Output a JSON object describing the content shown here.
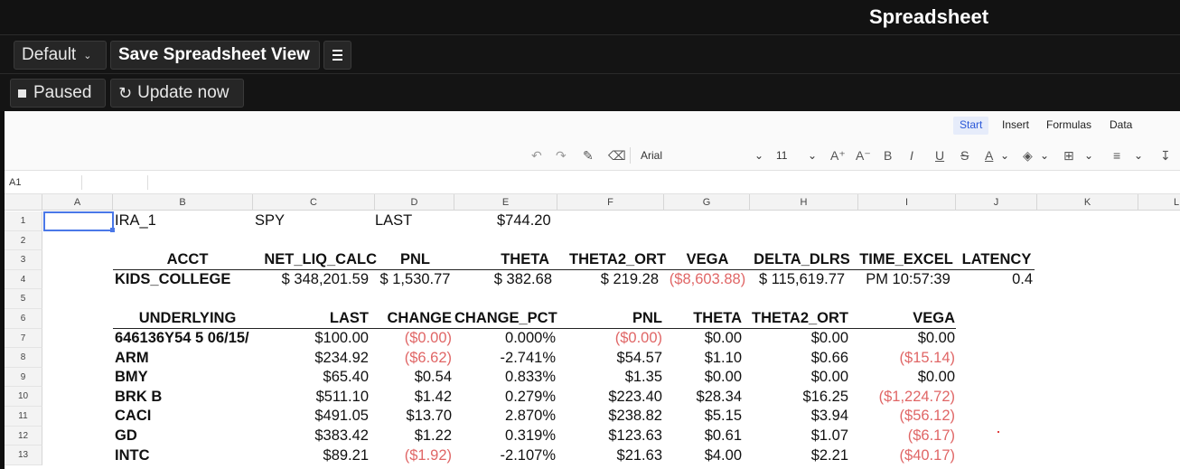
{
  "app": {
    "title": "Spreadsheet"
  },
  "toolbar": {
    "view_select": "Default",
    "save_label": "Save Spreadsheet View",
    "paused_label": "Paused",
    "update_label": "Update now"
  },
  "ribbon": {
    "tabs": [
      "Start",
      "Insert",
      "Formulas",
      "Data"
    ],
    "active_tab": "Start",
    "font": "Arial",
    "font_size": "11",
    "formula_bar": {
      "cell_ref": "A1",
      "content": ""
    }
  },
  "grid": {
    "columns": [
      "A",
      "B",
      "C",
      "D",
      "E",
      "F",
      "G",
      "H",
      "I",
      "J",
      "K",
      "L"
    ],
    "rows": [
      "1",
      "2",
      "3",
      "4",
      "5",
      "6",
      "7",
      "8",
      "9",
      "10",
      "11",
      "12",
      "13"
    ],
    "selected_cell": "A1",
    "r1": {
      "b": "IRA_1",
      "c": "SPY",
      "d": "LAST",
      "e": "$744.20"
    },
    "acct_headers": [
      "ACCT",
      "NET_LIQ_CALC",
      "PNL",
      "THETA",
      "THETA2_ORT",
      "VEGA",
      "DELTA_DLRS",
      "TIME_EXCEL",
      "LATENCY"
    ],
    "acct_row": [
      "KIDS_COLLEGE",
      "$ 348,201.59",
      "$ 1,530.77",
      "$ 382.68",
      "$ 219.28",
      "($8,603.88)",
      "$ 115,619.77",
      "PM 10:57:39",
      "0.4"
    ],
    "pos_headers": [
      "UNDERLYING",
      "LAST",
      "CHANGE",
      "CHANGE_PCT",
      "PNL",
      "THETA",
      "THETA2_ORT",
      "VEGA"
    ],
    "positions": [
      [
        "646136Y54 5 06/15/",
        "$100.00",
        "($0.00)",
        "0.000%",
        "($0.00)",
        "$0.00",
        "$0.00",
        "$0.00"
      ],
      [
        "ARM",
        "$234.92",
        "($6.62)",
        "-2.741%",
        "$54.57",
        "$1.10",
        "$0.66",
        "($15.14)"
      ],
      [
        "BMY",
        "$65.40",
        "$0.54",
        "0.833%",
        "$1.35",
        "$0.00",
        "$0.00",
        "$0.00"
      ],
      [
        "BRK B",
        "$511.10",
        "$1.42",
        "0.279%",
        "$223.40",
        "$28.34",
        "$16.25",
        "($1,224.72)"
      ],
      [
        "CACI",
        "$491.05",
        "$13.70",
        "2.870%",
        "$238.82",
        "$5.15",
        "$3.94",
        "($56.12)"
      ],
      [
        "GD",
        "$383.42",
        "$1.22",
        "0.319%",
        "$123.63",
        "$0.61",
        "$1.07",
        "($6.17)"
      ],
      [
        "INTC",
        "$89.21",
        "($1.92)",
        "-2.107%",
        "$21.63",
        "$4.00",
        "$2.21",
        "($40.17)"
      ]
    ],
    "colors": {
      "negative": "#e06666",
      "selection": "#4a78e8",
      "accent": "#2b58d8"
    }
  }
}
